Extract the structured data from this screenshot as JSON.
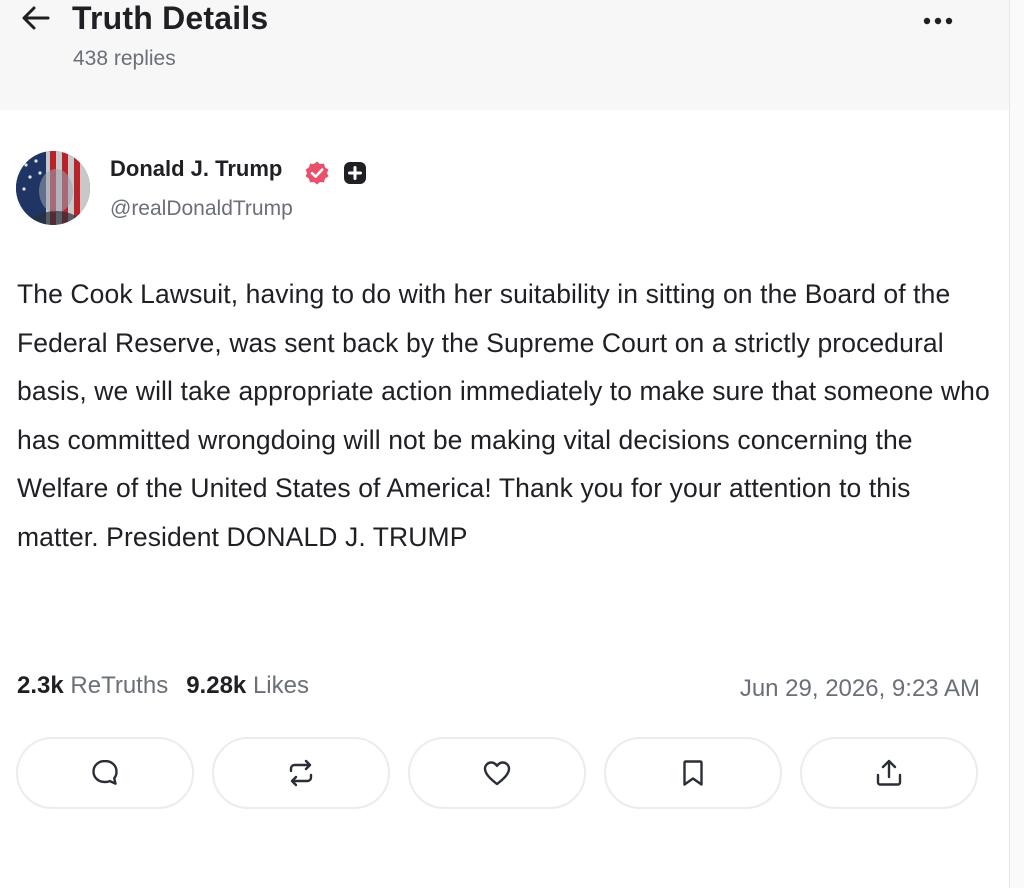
{
  "header": {
    "title": "Truth Details",
    "replies": "438 replies",
    "back_icon": "arrow-left-icon",
    "more_icon": "more-horizontal-icon"
  },
  "author": {
    "name": "Donald J. Trump",
    "handle": "@realDonaldTrump",
    "verified_color": "#e8506b"
  },
  "post": {
    "text": "The Cook Lawsuit, having to do with her suitability in sitting on the Board of the Federal Reserve, was sent back by the Supreme Court on a strictly procedural basis, we will take appropriate action immediately to make sure that someone who has committed wrongdoing will not be making vital decisions concerning the Welfare of the United States of America! Thank you for your attention to this matter. President DONALD J. TRUMP"
  },
  "stats": {
    "retruths_count": "2.3k",
    "retruths_label": "ReTruths",
    "likes_count": "9.28k",
    "likes_label": "Likes",
    "timestamp": "Jun 29, 2026, 9:23 AM"
  },
  "actions": [
    {
      "name": "reply-button",
      "icon": "comment-icon"
    },
    {
      "name": "retruth-button",
      "icon": "repost-icon"
    },
    {
      "name": "like-button",
      "icon": "heart-icon"
    },
    {
      "name": "bookmark-button",
      "icon": "bookmark-icon"
    },
    {
      "name": "share-button",
      "icon": "share-icon"
    }
  ]
}
